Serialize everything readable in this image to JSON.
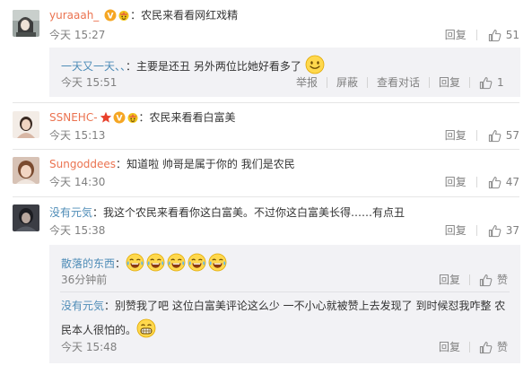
{
  "comments": [
    {
      "user": "yuraaah_",
      "sep": "：",
      "text": "农民来看看网红戏精",
      "time": "今天 15:27",
      "reply_label": "回复",
      "likes": "51"
    },
    {
      "user": "SSNEHC-",
      "sep": "：",
      "text": "农民来看看白富美",
      "time": "今天 15:13",
      "reply_label": "回复",
      "likes": "57"
    },
    {
      "user": "Sungoddees",
      "sep": "：",
      "text": "知道啦  帅哥是属于你的  我们是农民",
      "time": "今天 14:30",
      "reply_label": "回复",
      "likes": "47"
    },
    {
      "user": "没有元気",
      "sep": "：",
      "text": "我这个农民来看看你这白富美。不过你这白富美长得……有点丑",
      "time": "今天 15:38",
      "reply_label": "回复",
      "likes": "37"
    }
  ],
  "replies": {
    "r1": {
      "user": "一天又一天、、",
      "sep": "：",
      "text": "主要是还丑  另外两位比她好看多了",
      "time": "今天 15:51",
      "report_label": "举报",
      "block_label": "屏蔽",
      "view_label": "查看对话",
      "reply_label": "回复",
      "likes": "1"
    },
    "r2": {
      "user": "散落的东西",
      "sep": "：",
      "time": "36分钟前",
      "reply_label": "回复",
      "like_label": "赞"
    },
    "r3": {
      "user": "没有元気",
      "sep": "：",
      "text_line1": "别赞我了吧  这位白富美评论这么少  一不小心就被赞上去发现了  到时候怼我咋整  农",
      "text_line2": "民本人很怕的。",
      "time": "今天 15:48",
      "reply_label": "回复",
      "like_label": "赞"
    }
  },
  "colors": {
    "username": "#eb7350",
    "reply_username": "#4e8cb7",
    "meta": "#808080",
    "reply_bg": "#f2f2f5"
  },
  "icons": [
    "thumb-up-icon",
    "vip-badge-icon",
    "star-badge-icon",
    "smile-emoji-icon",
    "laugh-cry-emoji-icon",
    "grin-emoji-icon"
  ]
}
